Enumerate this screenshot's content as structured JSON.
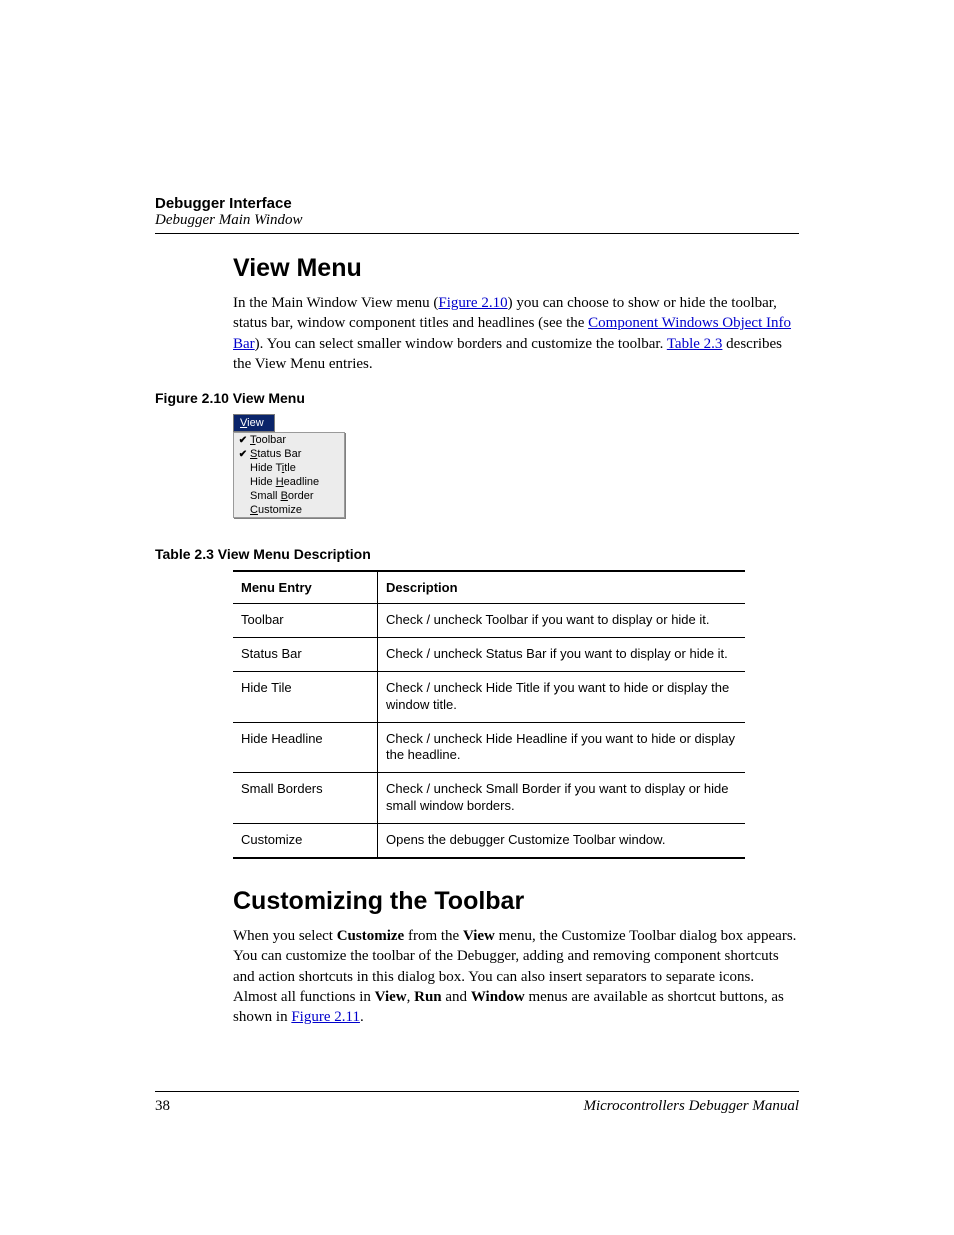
{
  "header": {
    "title": "Debugger Interface",
    "subtitle": "Debugger Main Window"
  },
  "section1": {
    "title": "View Menu",
    "para_pre": "In the Main Window View menu (",
    "link1": "Figure 2.10",
    "para_mid1": ") you can choose to show or hide the toolbar, status bar, window component titles and headlines (see the ",
    "link2": "Component Windows Object Info Bar",
    "para_mid2": "). You can select smaller window borders and customize the toolbar. ",
    "link3": "Table 2.3",
    "para_end": " describes the View Menu entries."
  },
  "figure": {
    "caption": "Figure 2.10  View Menu",
    "menu_label_prefix": "V",
    "menu_label_suffix": "iew",
    "items": [
      {
        "checked": true,
        "pre": "",
        "u": "T",
        "post": "oolbar"
      },
      {
        "checked": true,
        "pre": "",
        "u": "S",
        "post": "tatus Bar"
      },
      {
        "checked": false,
        "pre": "Hide T",
        "u": "i",
        "post": "tle"
      },
      {
        "checked": false,
        "pre": "Hide ",
        "u": "H",
        "post": "eadline"
      },
      {
        "checked": false,
        "pre": "Small ",
        "u": "B",
        "post": "order"
      },
      {
        "checked": false,
        "pre": "",
        "u": "C",
        "post": "ustomize"
      }
    ]
  },
  "table": {
    "caption": "Table 2.3  View Menu Description",
    "head_entry": "Menu Entry",
    "head_desc": "Description",
    "rows": [
      {
        "entry": "Toolbar",
        "desc": "Check / uncheck Toolbar if you want to display or hide it."
      },
      {
        "entry": "Status Bar",
        "desc": "Check / uncheck Status Bar if you want to display or hide it."
      },
      {
        "entry": "Hide Tile",
        "desc": "Check / uncheck Hide Title if you want to hide or display the window title."
      },
      {
        "entry": "Hide Headline",
        "desc": "Check / uncheck Hide Headline if you want to hide or display the headline."
      },
      {
        "entry": "Small Borders",
        "desc": "Check / uncheck Small Border if you want to display or hide small window borders."
      },
      {
        "entry": "Customize",
        "desc": "Opens the debugger Customize Toolbar window."
      }
    ]
  },
  "section2": {
    "title": "Customizing the Toolbar",
    "p1": "When you select ",
    "b1": "Customize",
    "p2": " from the ",
    "b2": "View",
    "p3": " menu, the Customize Toolbar dialog box appears. You can customize the toolbar of the Debugger, adding and removing component shortcuts and action shortcuts in this dialog box. You can also insert separators to separate icons. Almost all functions in ",
    "b3": "View",
    "p4": ", ",
    "b4": "Run",
    "p5": " and ",
    "b5": "Window",
    "p6": " menus are available as shortcut buttons, as shown in ",
    "link": "Figure 2.11",
    "p7": "."
  },
  "footer": {
    "page": "38",
    "book": "Microcontrollers Debugger Manual"
  }
}
